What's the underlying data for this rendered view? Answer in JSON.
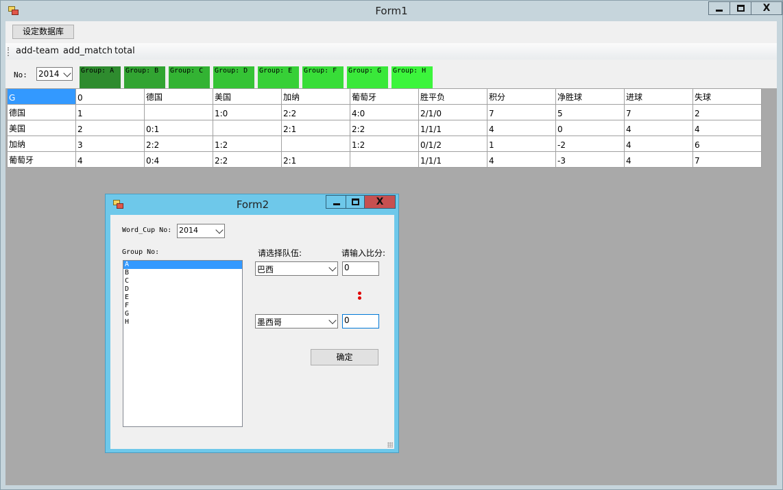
{
  "form1": {
    "title": "Form1",
    "set_db_button": "设定数据库",
    "menu": [
      "add-team",
      "add_match",
      "total"
    ],
    "no_label": "No:",
    "year_value": "2014",
    "groups": [
      {
        "label": "Group: A",
        "color": "#2e8b2e"
      },
      {
        "label": "Group: B",
        "color": "#32a432"
      },
      {
        "label": "Group: C",
        "color": "#33b333"
      },
      {
        "label": "Group: D",
        "color": "#35c335"
      },
      {
        "label": "Group: E",
        "color": "#37d037"
      },
      {
        "label": "Group: F",
        "color": "#38dd38"
      },
      {
        "label": "Group: G",
        "color": "#3ae83a"
      },
      {
        "label": "Group: H",
        "color": "#3cf53c"
      }
    ],
    "table": {
      "header": [
        "G",
        "0",
        "德国",
        "美国",
        "加纳",
        "葡萄牙",
        "胜平负",
        "积分",
        "净胜球",
        "进球",
        "失球"
      ],
      "rows": [
        [
          "德国",
          "1",
          "",
          "1:0",
          "2:2",
          "4:0",
          "2/1/0",
          "7",
          "5",
          "7",
          "2"
        ],
        [
          "美国",
          "2",
          "0:1",
          "",
          "2:1",
          "2:2",
          "1/1/1",
          "4",
          "0",
          "4",
          "4"
        ],
        [
          "加纳",
          "3",
          "2:2",
          "1:2",
          "",
          "1:2",
          "0/1/2",
          "1",
          "-2",
          "4",
          "6"
        ],
        [
          "葡萄牙",
          "4",
          "0:4",
          "2:2",
          "2:1",
          "",
          "1/1/1",
          "4",
          "-3",
          "4",
          "7"
        ]
      ]
    }
  },
  "form2": {
    "title": "Form2",
    "cup_label": "Word_Cup No:",
    "cup_value": "2014",
    "group_label": "Group No:",
    "group_items": [
      "A",
      "B",
      "C",
      "D",
      "E",
      "F",
      "G",
      "H"
    ],
    "selected_group": "A",
    "select_team_label": "请选择队伍:",
    "score_label": "请输入比分:",
    "team1": "巴西",
    "team2": "墨西哥",
    "score1": "0",
    "score2": "0",
    "confirm_button": "确定"
  },
  "icons": {
    "minimize": "minimize-icon",
    "maximize": "maximize-icon",
    "close": "close-icon",
    "app": "app-icon"
  }
}
